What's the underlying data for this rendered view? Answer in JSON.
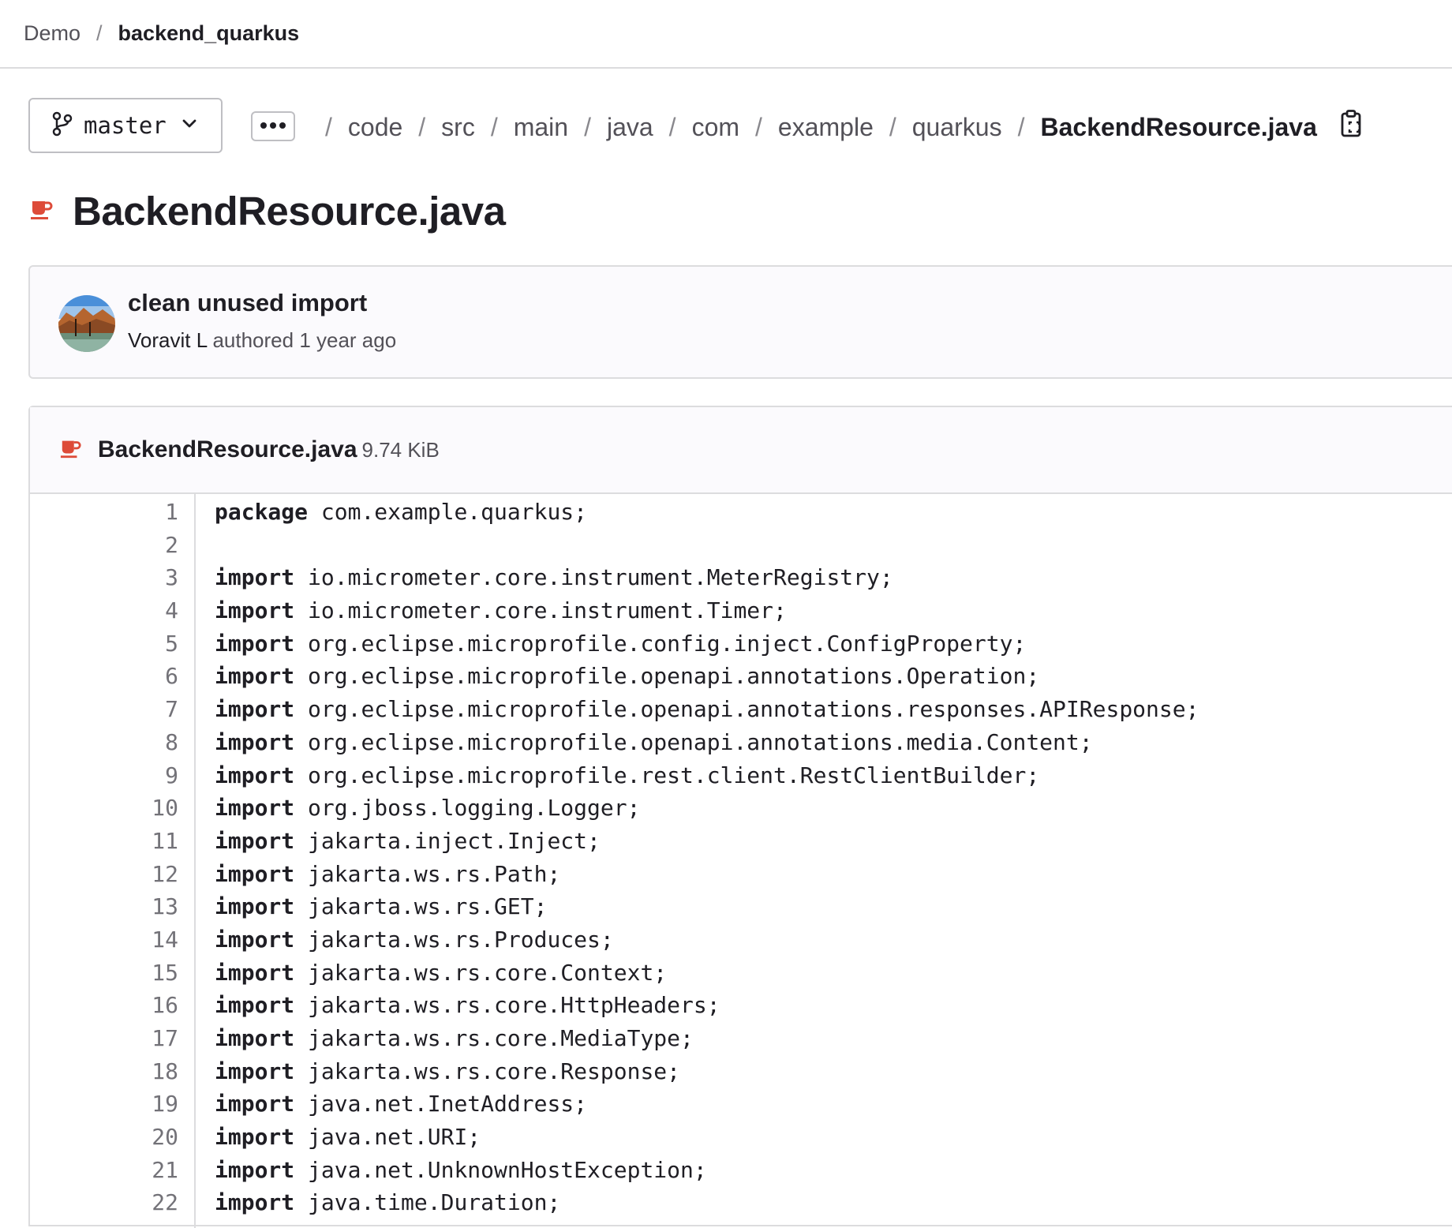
{
  "breadcrumb": {
    "group": "Demo",
    "separator": "/",
    "project": "backend_quarkus"
  },
  "branch": {
    "name": "master"
  },
  "path": {
    "segments": [
      "code",
      "src",
      "main",
      "java",
      "com",
      "example",
      "quarkus"
    ],
    "current": "BackendResource.java"
  },
  "file": {
    "title": "BackendResource.java",
    "name": "BackendResource.java",
    "size": "9.74 KiB"
  },
  "commit": {
    "message": "clean unused import",
    "author": "Voravit L",
    "meta": "authored 1 year ago"
  },
  "code": {
    "line_numbers": [
      "1",
      "2",
      "3",
      "4",
      "5",
      "6",
      "7",
      "8",
      "9",
      "10",
      "11",
      "12",
      "13",
      "14",
      "15",
      "16",
      "17",
      "18",
      "19",
      "20",
      "21",
      "22"
    ],
    "lines": [
      {
        "kw": "package",
        "rest": " com.example.quarkus;"
      },
      {
        "kw": "",
        "rest": ""
      },
      {
        "kw": "import",
        "rest": " io.micrometer.core.instrument.MeterRegistry;"
      },
      {
        "kw": "import",
        "rest": " io.micrometer.core.instrument.Timer;"
      },
      {
        "kw": "import",
        "rest": " org.eclipse.microprofile.config.inject.ConfigProperty;"
      },
      {
        "kw": "import",
        "rest": " org.eclipse.microprofile.openapi.annotations.Operation;"
      },
      {
        "kw": "import",
        "rest": " org.eclipse.microprofile.openapi.annotations.responses.APIResponse;"
      },
      {
        "kw": "import",
        "rest": " org.eclipse.microprofile.openapi.annotations.media.Content;"
      },
      {
        "kw": "import",
        "rest": " org.eclipse.microprofile.rest.client.RestClientBuilder;"
      },
      {
        "kw": "import",
        "rest": " org.jboss.logging.Logger;"
      },
      {
        "kw": "import",
        "rest": " jakarta.inject.Inject;"
      },
      {
        "kw": "import",
        "rest": " jakarta.ws.rs.Path;"
      },
      {
        "kw": "import",
        "rest": " jakarta.ws.rs.GET;"
      },
      {
        "kw": "import",
        "rest": " jakarta.ws.rs.Produces;"
      },
      {
        "kw": "import",
        "rest": " jakarta.ws.rs.core.Context;"
      },
      {
        "kw": "import",
        "rest": " jakarta.ws.rs.core.HttpHeaders;"
      },
      {
        "kw": "import",
        "rest": " jakarta.ws.rs.core.MediaType;"
      },
      {
        "kw": "import",
        "rest": " jakarta.ws.rs.core.Response;"
      },
      {
        "kw": "import",
        "rest": " java.net.InetAddress;"
      },
      {
        "kw": "import",
        "rest": " java.net.URI;"
      },
      {
        "kw": "import",
        "rest": " java.net.UnknownHostException;"
      },
      {
        "kw": "import",
        "rest": " java.time.Duration;"
      }
    ]
  },
  "icons": {
    "branch": "branch-icon",
    "chevron": "chevron-down-icon",
    "more": "ellipsis-icon",
    "copy": "copy-path-icon",
    "java": "java-file-icon"
  },
  "colors": {
    "java_icon": "#dd4b39",
    "border": "#dcdcde",
    "muted_text": "#535158"
  }
}
